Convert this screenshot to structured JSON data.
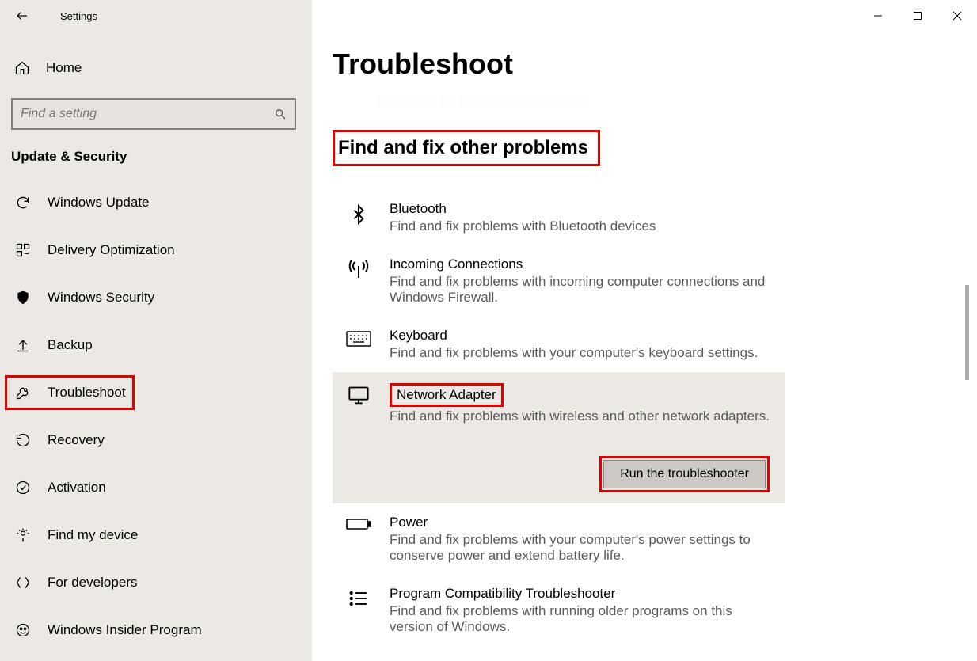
{
  "titlebar": {
    "title": "Settings"
  },
  "sidebar": {
    "home": "Home",
    "search_placeholder": "Find a setting",
    "section": "Update & Security",
    "items": [
      {
        "label": "Windows Update"
      },
      {
        "label": "Delivery Optimization"
      },
      {
        "label": "Windows Security"
      },
      {
        "label": "Backup"
      },
      {
        "label": "Troubleshoot"
      },
      {
        "label": "Recovery"
      },
      {
        "label": "Activation"
      },
      {
        "label": "Find my device"
      },
      {
        "label": "For developers"
      },
      {
        "label": "Windows Insider Program"
      }
    ]
  },
  "main": {
    "page_title": "Troubleshoot",
    "cutoff_line": "…  …  …  …  …  …  …  …  …  …  …",
    "section_heading": "Find and fix other problems",
    "run_button": "Run the troubleshooter",
    "items": [
      {
        "title": "Bluetooth",
        "desc": "Find and fix problems with Bluetooth devices"
      },
      {
        "title": "Incoming Connections",
        "desc": "Find and fix problems with incoming computer connections and Windows Firewall."
      },
      {
        "title": "Keyboard",
        "desc": "Find and fix problems with your computer's keyboard settings."
      },
      {
        "title": "Network Adapter",
        "desc": "Find and fix problems with wireless and other network adapters."
      },
      {
        "title": "Power",
        "desc": "Find and fix problems with your computer's power settings to conserve power and extend battery life."
      },
      {
        "title": "Program Compatibility Troubleshooter",
        "desc": "Find and fix problems with running older programs on this version of Windows."
      }
    ]
  }
}
